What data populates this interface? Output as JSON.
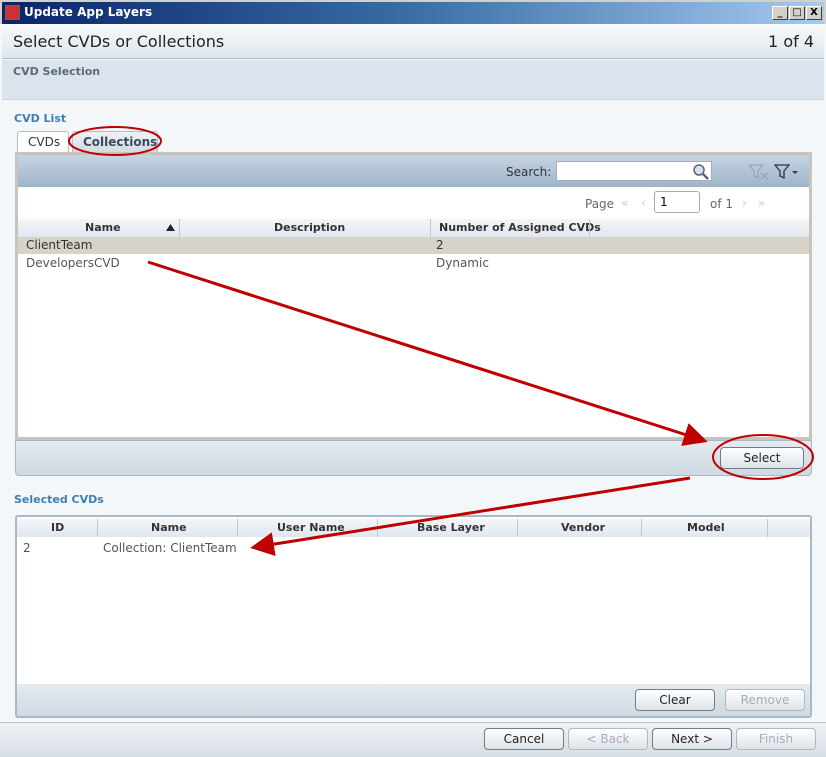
{
  "window": {
    "title": "Update App Layers",
    "buttons": [
      "_",
      "□",
      "X"
    ]
  },
  "header": {
    "title": "Select CVDs or Collections",
    "step": "1 of 4"
  },
  "section": {
    "title": "CVD Selection"
  },
  "cvd_list": {
    "label": "CVD List",
    "tabs": [
      {
        "label": "CVDs",
        "active": true
      },
      {
        "label": "Collections",
        "active": false
      }
    ],
    "search": {
      "label": "Search:",
      "value": "",
      "placeholder": ""
    },
    "icons": [
      "search-icon",
      "clear-filter-icon",
      "filter-icon"
    ],
    "pager": {
      "label": "Page",
      "value": "1",
      "of": "of 1",
      "first": "«",
      "prev": "‹",
      "next": "›",
      "last": "»"
    },
    "columns": [
      "Name",
      "Description",
      "Number of Assigned CVDs"
    ],
    "rows": [
      {
        "name": "ClientTeam",
        "description": "",
        "count": "2",
        "selected": true
      },
      {
        "name": "DevelopersCVD",
        "description": "",
        "count": "Dynamic",
        "selected": false
      }
    ],
    "select_button": "Select"
  },
  "selected_cvds": {
    "label": "Selected CVDs",
    "columns": [
      "ID",
      "Name",
      "User Name",
      "Base Layer",
      "Vendor",
      "Model"
    ],
    "rows": [
      {
        "id": "2",
        "name": "Collection: ClientTeam",
        "user": "",
        "base": "",
        "vendor": "",
        "model": ""
      }
    ],
    "clear_button": "Clear",
    "remove_button": "Remove"
  },
  "footer": {
    "cancel": "Cancel",
    "back": "< Back",
    "next": "Next >",
    "finish": "Finish"
  },
  "colors": {
    "annotation": "#c00000",
    "section_label": "#3c7fb1",
    "selected_row": "#d8d2c8"
  }
}
